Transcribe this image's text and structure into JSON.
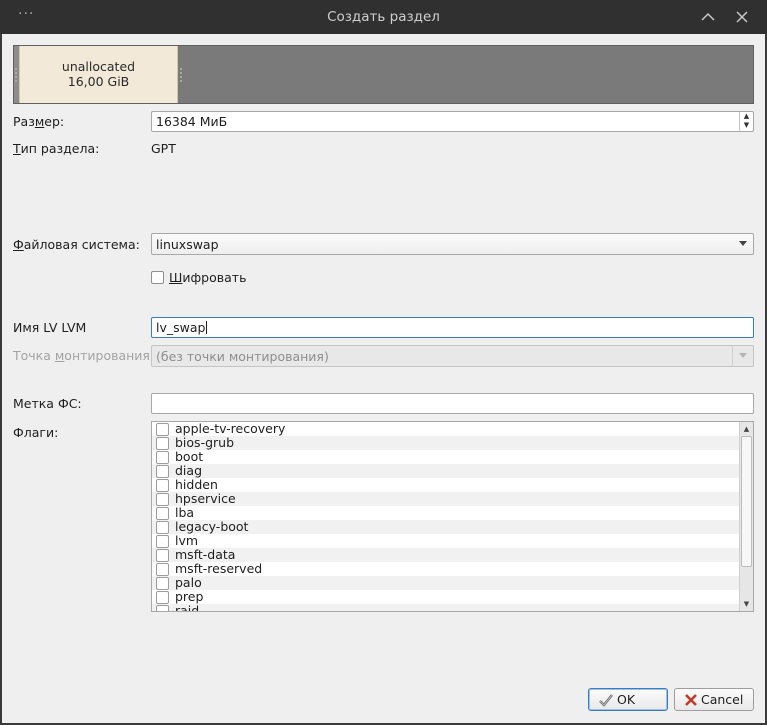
{
  "window": {
    "menu_glyph": "···",
    "title": "Создать раздел",
    "icons": [
      "chevron-up-icon",
      "close-icon"
    ]
  },
  "graph": {
    "partition_name": "unallocated",
    "partition_size": "16,00 GiB"
  },
  "form": {
    "size_label_pre": "Раз",
    "size_label_u": "м",
    "size_label_post": "ер:",
    "size_value": "16384 МиБ",
    "parttype_label_u": "Т",
    "parttype_label_post": "ип раздела:",
    "parttype_value": "GPT",
    "fs_label_u": "Ф",
    "fs_label_post": "айловая система:",
    "fs_value": "linuxswap",
    "encrypt_label_u": "Ш",
    "encrypt_label_post": "ифровать",
    "lvm_label": "Имя LV LVM",
    "lvm_value": "lv_swap",
    "mount_label_pre": "Точка ",
    "mount_label_u": "м",
    "mount_label_post": "онтирования",
    "mount_value": "(без точки монтирования)",
    "fslabel_label": "Метка ФС:",
    "fslabel_value": "",
    "flags_label": "Флаги:"
  },
  "flags": [
    "apple-tv-recovery",
    "bios-grub",
    "boot",
    "diag",
    "hidden",
    "hpservice",
    "lba",
    "legacy-boot",
    "lvm",
    "msft-data",
    "msft-reserved",
    "palo",
    "prep",
    "raid"
  ],
  "buttons": {
    "ok_label": "OK",
    "cancel_label": "Cancel"
  },
  "colors": {
    "accent": "#3a7bc1",
    "partition_fill": "#f2e9d8",
    "graph_bg": "#7a7a7a"
  }
}
